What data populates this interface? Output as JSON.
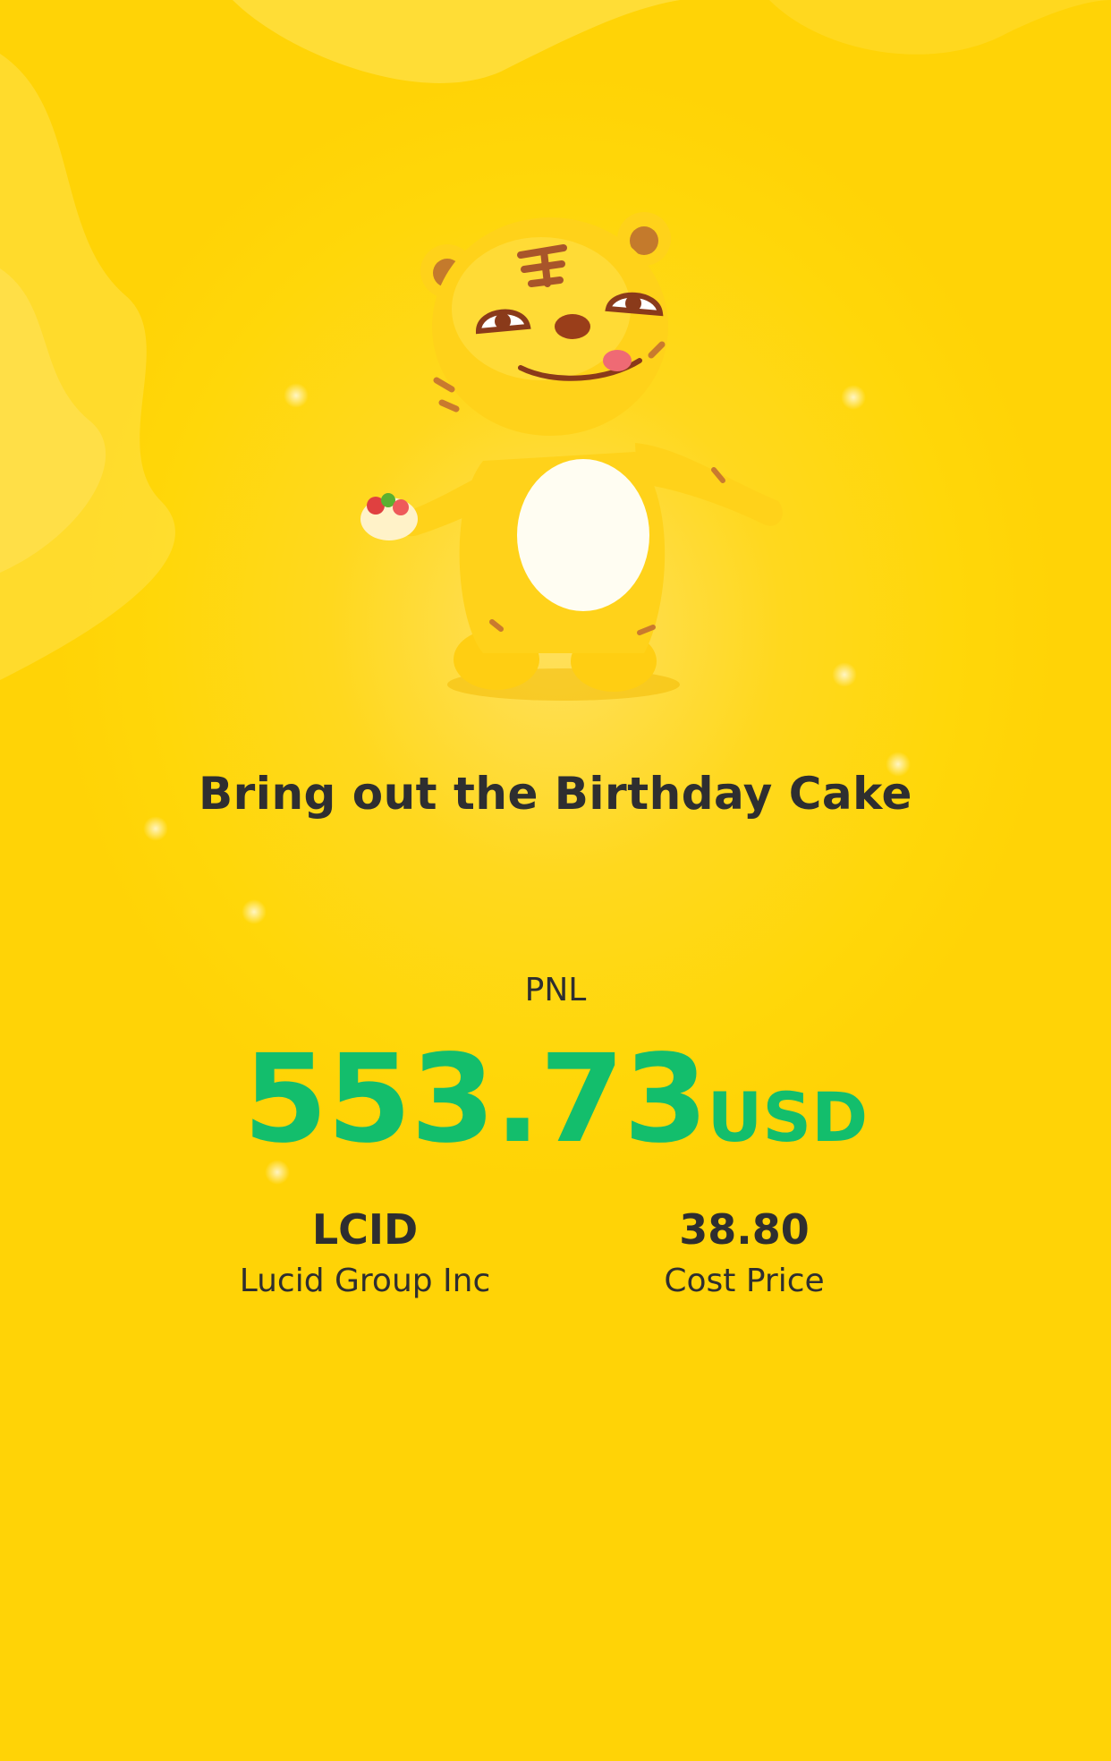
{
  "headline": "Bring out the Birthday Cake",
  "pnl": {
    "label": "PNL",
    "amount": "553.73",
    "unit": "USD"
  },
  "stock": {
    "symbol": "LCID",
    "name": "Lucid Group Inc"
  },
  "cost": {
    "value": "38.80",
    "label": "Cost Price"
  },
  "colors": {
    "background": "#ffd709",
    "profit_green": "#13be6c",
    "text_dark": "#2e2e30"
  }
}
